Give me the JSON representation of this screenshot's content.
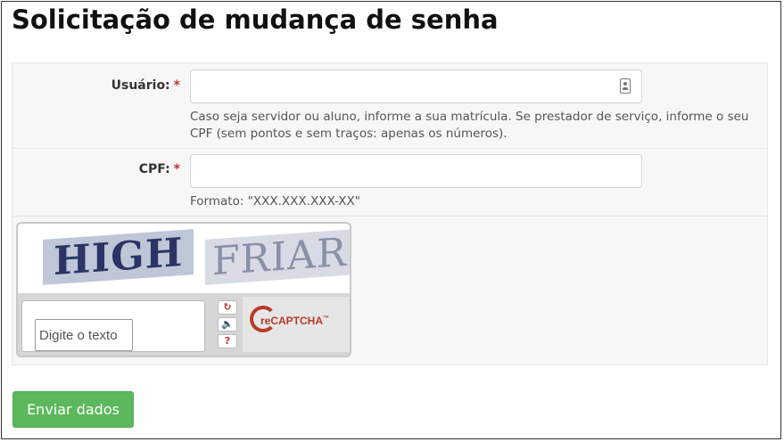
{
  "page": {
    "title": "Solicitação de mudança de senha"
  },
  "form": {
    "usuario": {
      "label": "Usuário:",
      "required_mark": "*",
      "value": "",
      "help": "Caso seja servidor ou aluno, informe a sua matrícula. Se prestador de serviço, informe o seu CPF (sem pontos e sem traços: apenas os números).",
      "icon": "contact-card-icon"
    },
    "cpf": {
      "label": "CPF:",
      "required_mark": "*",
      "value": "",
      "help": "Formato: \"XXX.XXX.XXX-XX\""
    },
    "captcha": {
      "word_1": "HIGH",
      "word_2": "FRIAR",
      "input_placeholder": "Digite o texto",
      "refresh_icon": "refresh-icon",
      "audio_icon": "audio-icon",
      "help_icon": "help-icon",
      "logo_text": "reCAPTCHA",
      "logo_mark": "™"
    },
    "submit_label": "Enviar dados"
  },
  "colors": {
    "submit": "#5cb85c",
    "required": "#c9302c",
    "recaptcha": "#b93a2b"
  }
}
